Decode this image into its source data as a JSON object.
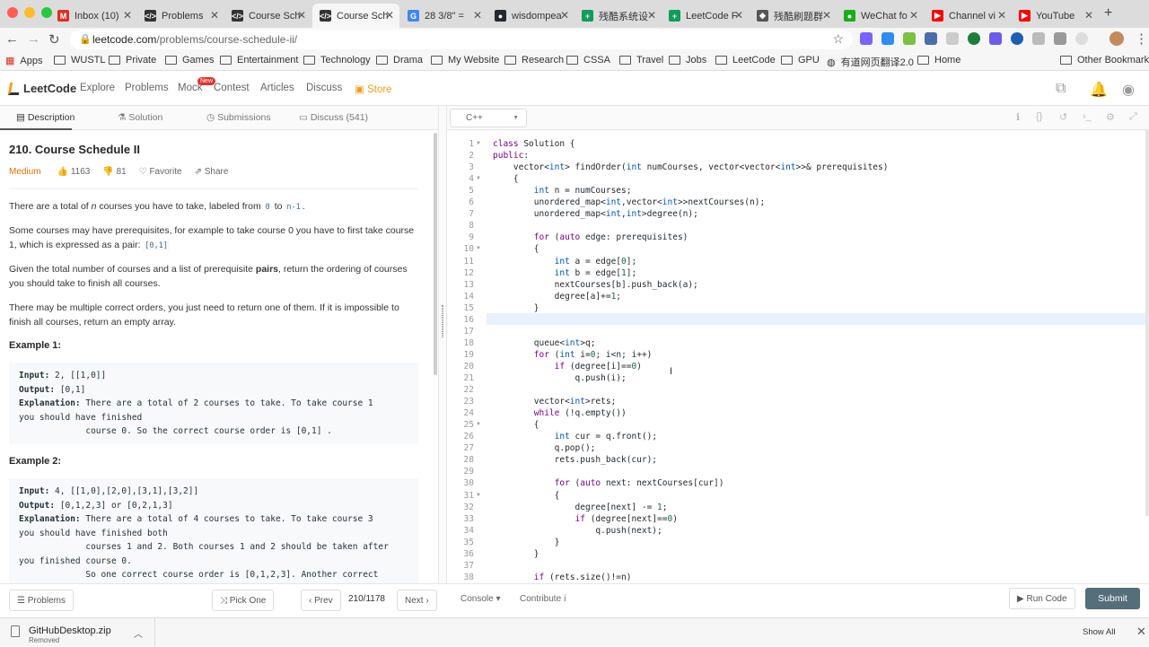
{
  "browser": {
    "tabs": [
      {
        "label": "Inbox (10)",
        "fav_color": "#d93025",
        "fav_glyph": "M"
      },
      {
        "label": "Problems",
        "fav_color": "#333333",
        "fav_glyph": "</>"
      },
      {
        "label": "Course Sch",
        "fav_color": "#333333",
        "fav_glyph": "</>"
      },
      {
        "label": "Course Sch",
        "fav_color": "#333333",
        "fav_glyph": "</>"
      },
      {
        "label": "28 3/8\" = ",
        "fav_color": "#4285f4",
        "fav_glyph": "G"
      },
      {
        "label": "wisdompea",
        "fav_color": "#24292e",
        "fav_glyph": "●"
      },
      {
        "label": "残酷系统设",
        "fav_color": "#0f9d58",
        "fav_glyph": "+"
      },
      {
        "label": "LeetCode F",
        "fav_color": "#0f9d58",
        "fav_glyph": "+"
      },
      {
        "label": "残酷刷题群",
        "fav_color": "#555555",
        "fav_glyph": "◆"
      },
      {
        "label": "WeChat fo",
        "fav_color": "#1aad19",
        "fav_glyph": "●"
      },
      {
        "label": "Channel vi",
        "fav_color": "#ff0000",
        "fav_glyph": "▶"
      },
      {
        "label": "YouTube",
        "fav_color": "#ff0000",
        "fav_glyph": "▶"
      }
    ],
    "active_tab_index": 3,
    "new_tab": "+",
    "url_host": "leetcode.com",
    "url_path": "/problems/course-schedule-ii/",
    "bookmarks": [
      {
        "label": "Apps",
        "icon": "apps-grid-icon"
      },
      {
        "label": "WUSTL",
        "icon": "folder-icon"
      },
      {
        "label": "Private",
        "icon": "folder-icon"
      },
      {
        "label": "Games",
        "icon": "folder-icon"
      },
      {
        "label": "Entertainment",
        "icon": "folder-icon"
      },
      {
        "label": "Technology",
        "icon": "folder-icon"
      },
      {
        "label": "Drama",
        "icon": "folder-icon"
      },
      {
        "label": "My Website",
        "icon": "folder-icon"
      },
      {
        "label": "Research",
        "icon": "folder-icon"
      },
      {
        "label": "CSSA",
        "icon": "folder-icon"
      },
      {
        "label": "Travel",
        "icon": "folder-icon"
      },
      {
        "label": "Jobs",
        "icon": "folder-icon"
      },
      {
        "label": "LeetCode",
        "icon": "folder-icon"
      },
      {
        "label": "GPU",
        "icon": "folder-icon"
      },
      {
        "label": "有道网页翻译2.0",
        "icon": "globe-icon"
      },
      {
        "label": "Home",
        "icon": "folder-icon"
      }
    ],
    "other_bookmarks": "Other Bookmarks"
  },
  "header": {
    "logo": "LeetCode",
    "nav": [
      "Explore",
      "Problems",
      "Mock",
      "Contest",
      "Articles",
      "Discuss",
      "Store"
    ],
    "new_badge": "New"
  },
  "left_tabs": [
    "Description",
    "Solution",
    "Submissions",
    "Discuss (541)"
  ],
  "problem": {
    "title": "210. Course Schedule II",
    "difficulty": "Medium",
    "likes": "1163",
    "dislikes": "81",
    "favorite": "Favorite",
    "share": "Share",
    "p1_a": "There are a total of ",
    "p1_n": "n",
    "p1_b": " courses you have to take, labeled from ",
    "p1_c0": "0",
    "p1_to": " to ",
    "p1_c1": "n-1",
    "p1_end": ".",
    "p2": "Some courses may have prerequisites, for example to take course 0 you have to first take course 1, which is expressed as a pair: ",
    "p2_code": "[0,1]",
    "p3_a": "Given the total number of courses and a list of prerequisite ",
    "p3_b": "pairs",
    "p3_c": ", return the ordering of courses you should take to finish all courses.",
    "p4": "There may be multiple correct orders, you just need to return one of them. If it is impossible to finish all courses, return an empty array.",
    "ex1_title": "Example 1:",
    "ex1_l1_k": "Input:",
    "ex1_l1_v": " 2, [[1,0]]",
    "ex1_l2_k": "Output:",
    "ex1_l2_v": " [0,1]",
    "ex1_l3_k": "Explanation:",
    "ex1_l3_v": " There are a total of 2 courses to take. To take course 1\nyou should have finished\n             course 0. So the correct course order is [0,1] .",
    "ex2_title": "Example 2:",
    "ex2_l1_k": "Input:",
    "ex2_l1_v": " 4, [[1,0],[2,0],[3,1],[3,2]]",
    "ex2_l2_k": "Output:",
    "ex2_l2_v": " [0,1,2,3] or [0,2,1,3]",
    "ex2_l3_k": "Explanation:",
    "ex2_l3_v": " There are a total of 4 courses to take. To take course 3\nyou should have finished both\n             courses 1 and 2. Both courses 1 and 2 should be taken after\nyou finished course 0.\n             So one correct course order is [0,1,2,3]. Another correct"
  },
  "editor": {
    "language": "C++",
    "lines": [
      "class Solution {",
      "public:",
      "    vector<int> findOrder(int numCourses, vector<vector<int>>& prerequisites)",
      "    {",
      "        int n = numCourses;",
      "        unordered_map<int,vector<int>>nextCourses(n);",
      "        unordered_map<int,int>degree(n);",
      "",
      "        for (auto edge: prerequisites)",
      "        {",
      "            int a = edge[0];",
      "            int b = edge[1];",
      "            nextCourses[b].push_back(a);",
      "            degree[a]+=1;",
      "        }",
      "",
      "",
      "        queue<int>q;",
      "        for (int i=0; i<n; i++)",
      "            if (degree[i]==0)",
      "                q.push(i);",
      "",
      "        vector<int>rets;",
      "        while (!q.empty())",
      "        {",
      "            int cur = q.front();",
      "            q.pop();",
      "            rets.push_back(cur);",
      "",
      "            for (auto next: nextCourses[cur])",
      "            {",
      "                degree[next] -= 1;",
      "                if (degree[next]==0)",
      "                    q.push(next);",
      "            }",
      "        }",
      "",
      "        if (rets.size()!=n)"
    ],
    "fold_lines": [
      1,
      4,
      10,
      25,
      31
    ]
  },
  "footer": {
    "problems": "Problems",
    "pick_one": "Pick One",
    "prev": "Prev",
    "counter": "210/1178",
    "next": "Next",
    "console": "Console",
    "contribute": "Contribute",
    "run": "Run Code",
    "submit": "Submit"
  },
  "download": {
    "file": "GitHubDesktop.zip",
    "status": "Removed",
    "show_all": "Show All"
  }
}
